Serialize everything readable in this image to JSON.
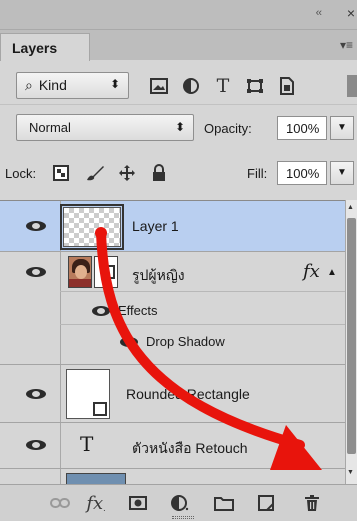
{
  "panel": {
    "collapse_glyph": "‹‹",
    "close_glyph": "×",
    "tab_label": "Layers",
    "menu_glyph": "▾≡"
  },
  "filter": {
    "search_glyph": "⌕",
    "kind_label": "Kind",
    "kind_arrows": "⬍"
  },
  "blend": {
    "mode": "Normal",
    "mode_arrows": "⬍",
    "opacity_label": "Opacity:",
    "opacity_value": "100%",
    "dropdown_glyph": "▼"
  },
  "lock": {
    "lock_label": "Lock:",
    "fill_label": "Fill:",
    "fill_value": "100%",
    "dropdown_glyph": "▼"
  },
  "layers": [
    {
      "name": "Layer 1",
      "selected": true
    },
    {
      "name": "รูปผู้หญิง",
      "fx": "fx",
      "fx_arrow": "▲",
      "effects_label": "Effects",
      "effect_item": "Drop Shadow"
    },
    {
      "name": "Rounded Rectangle"
    },
    {
      "name": "ตัวหนังสือ Retouch",
      "type_glyph": "T"
    }
  ],
  "scroll": {
    "up": "▲",
    "down": "▼"
  },
  "bottom": {
    "fx_label": "fx",
    "icons": [
      "link-icon",
      "fx-icon",
      "mask-icon",
      "adjustment-icon",
      "folder-icon",
      "new-layer-icon",
      "trash-icon"
    ]
  },
  "annotation": {
    "arrow_color": "#e8140c",
    "description_hidden": "drag Layer 1 to trash"
  },
  "colors": {
    "panel_bg": "#d6d6d6",
    "selection": "#b9cff0",
    "accent_arrow": "#e8140c"
  }
}
